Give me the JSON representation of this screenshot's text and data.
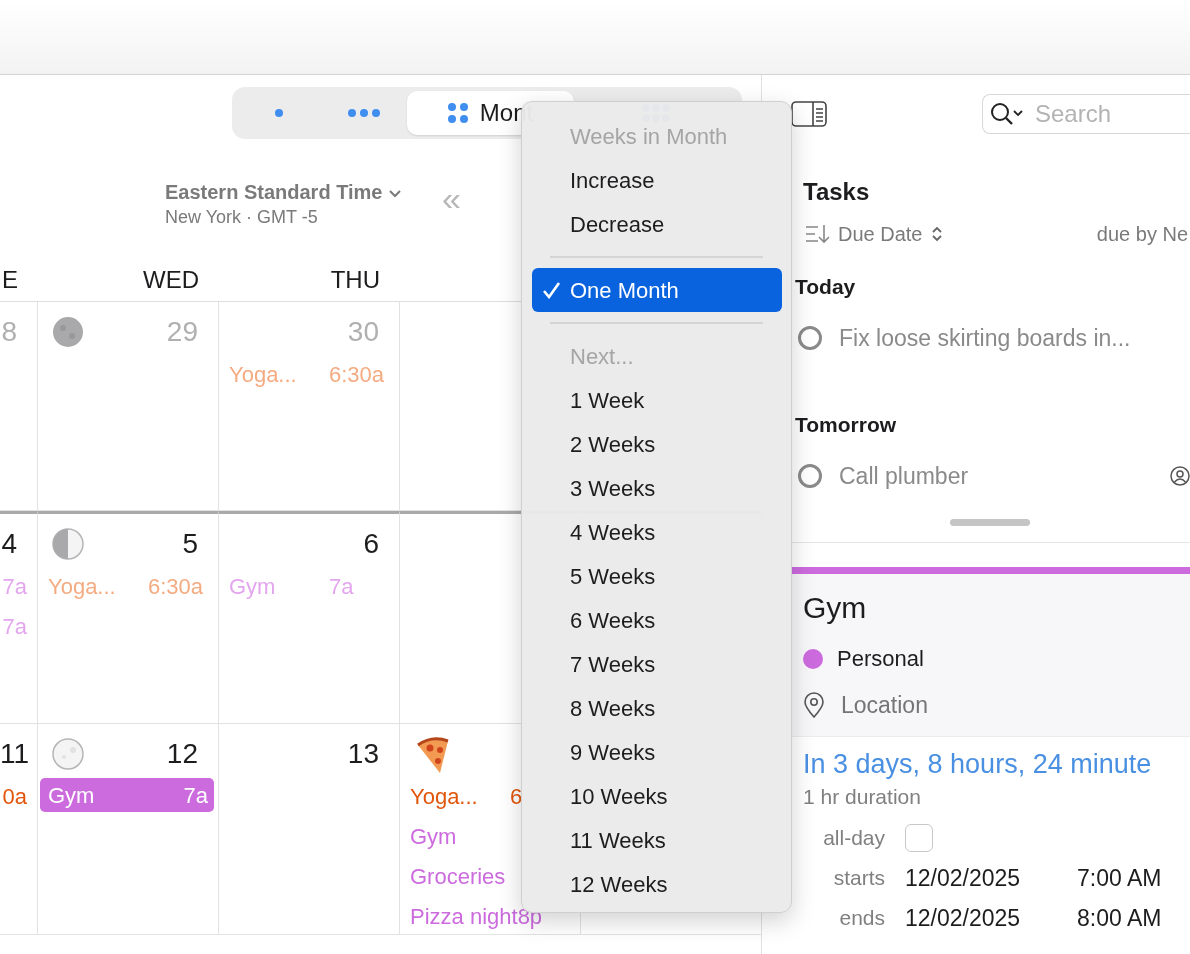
{
  "view_switcher": [
    {
      "kind": "day",
      "selected": false
    },
    {
      "kind": "week",
      "selected": false
    },
    {
      "kind": "month",
      "label": "Mont",
      "selected": true
    },
    {
      "kind": "year",
      "selected": false
    }
  ],
  "timezone": {
    "name": "Eastern Standard Time",
    "detail": "New York · GMT -5"
  },
  "back_button": "«",
  "weekdays": [
    "E",
    "WED",
    "THU"
  ],
  "weeks": [
    {
      "month_boundary_above": false,
      "days": [
        {
          "number": "8",
          "in_month": false
        },
        {
          "number": "29",
          "in_month": false,
          "badge": {
            "kind": "full_moon"
          }
        },
        {
          "number": "30",
          "in_month": false,
          "events": [
            {
              "title": "Yoga...",
              "time": "6:30a",
              "color": "#f5ab82",
              "filled": false
            }
          ]
        }
      ]
    },
    {
      "month_boundary_above": true,
      "days": [
        {
          "number": "4",
          "in_month": true,
          "events": [
            {
              "time": "7a",
              "color": "#e3a6ee",
              "filled": false
            },
            {
              "time": "7a",
              "color": "#e3a6ee",
              "filled": false
            }
          ]
        },
        {
          "number": "5",
          "in_month": true,
          "badge": {
            "kind": "first_quarter_moon"
          },
          "events": [
            {
              "title": "Yoga...",
              "time": "6:30a",
              "color": "#f5ab82",
              "filled": false
            }
          ]
        },
        {
          "number": "6",
          "in_month": true,
          "events": [
            {
              "title": "Gym",
              "time": "7a",
              "color": "#e3a6ee",
              "filled": false
            }
          ]
        }
      ]
    },
    {
      "month_boundary_above": false,
      "days": [
        {
          "number": "11",
          "in_month": true,
          "events": [
            {
              "time": "0a",
              "color": "#e2560c",
              "filled": false
            }
          ]
        },
        {
          "number": "12",
          "in_month": true,
          "badge": {
            "kind": "new_moon"
          },
          "events": [
            {
              "title": "Gym",
              "time": "7a",
              "color": "#cc6bde",
              "filled": true
            }
          ]
        },
        {
          "number": "13",
          "in_month": true
        },
        {
          "badge": {
            "kind": "pizza"
          },
          "events": [
            {
              "title": "Yoga...",
              "time": "6",
              "color": "#e2560c",
              "filled": false
            },
            {
              "title": "Gym",
              "color": "#cc6bde",
              "filled": false
            },
            {
              "title": "Groceries",
              "color": "#cc6bde",
              "filled": false
            },
            {
              "title": "Pizza night",
              "time": "8p",
              "color": "#cc6bde",
              "filled": false
            }
          ]
        }
      ]
    }
  ],
  "menu": [
    {
      "kind": "header",
      "label": "Weeks in Month"
    },
    {
      "kind": "item",
      "label": "Increase",
      "selected": false
    },
    {
      "kind": "item",
      "label": "Decrease",
      "selected": false
    },
    {
      "kind": "separator"
    },
    {
      "kind": "item",
      "label": "One Month",
      "selected": true
    },
    {
      "kind": "separator"
    },
    {
      "kind": "header",
      "label": "Next..."
    },
    {
      "kind": "item",
      "label": "1 Week",
      "selected": false
    },
    {
      "kind": "item",
      "label": "2 Weeks",
      "selected": false
    },
    {
      "kind": "item",
      "label": "3 Weeks",
      "selected": false
    },
    {
      "kind": "item",
      "label": "4 Weeks",
      "selected": false
    },
    {
      "kind": "item",
      "label": "5 Weeks",
      "selected": false
    },
    {
      "kind": "item",
      "label": "6 Weeks",
      "selected": false
    },
    {
      "kind": "item",
      "label": "7 Weeks",
      "selected": false
    },
    {
      "kind": "item",
      "label": "8 Weeks",
      "selected": false
    },
    {
      "kind": "item",
      "label": "9 Weeks",
      "selected": false
    },
    {
      "kind": "item",
      "label": "10 Weeks",
      "selected": false
    },
    {
      "kind": "item",
      "label": "11 Weeks",
      "selected": false
    },
    {
      "kind": "item",
      "label": "12 Weeks",
      "selected": false
    }
  ],
  "search": {
    "placeholder": "Search"
  },
  "tasks": {
    "title": "Tasks",
    "sort": "Due Date",
    "filter": "due by Ne",
    "sections": [
      {
        "title": "Today",
        "tasks": [
          {
            "title": "Fix loose skirting boards in...",
            "done": false,
            "assignee": false
          }
        ]
      },
      {
        "title": "Tomorrow",
        "tasks": [
          {
            "title": "Call plumber",
            "done": false,
            "assignee": true
          }
        ]
      }
    ]
  },
  "event_detail": {
    "title": "Gym",
    "calendar": {
      "name": "Personal",
      "color": "#cc6bde"
    },
    "location_placeholder": "Location",
    "relative_time": "In 3 days, 8 hours, 24 minute",
    "duration": "1 hr duration",
    "all_day": {
      "label": "all-day",
      "checked": false
    },
    "times": [
      {
        "label": "starts",
        "date": "12/02/2025",
        "time": "7:00 AM"
      },
      {
        "label": "ends",
        "date": "12/02/2025",
        "time": "8:00 AM"
      }
    ]
  }
}
